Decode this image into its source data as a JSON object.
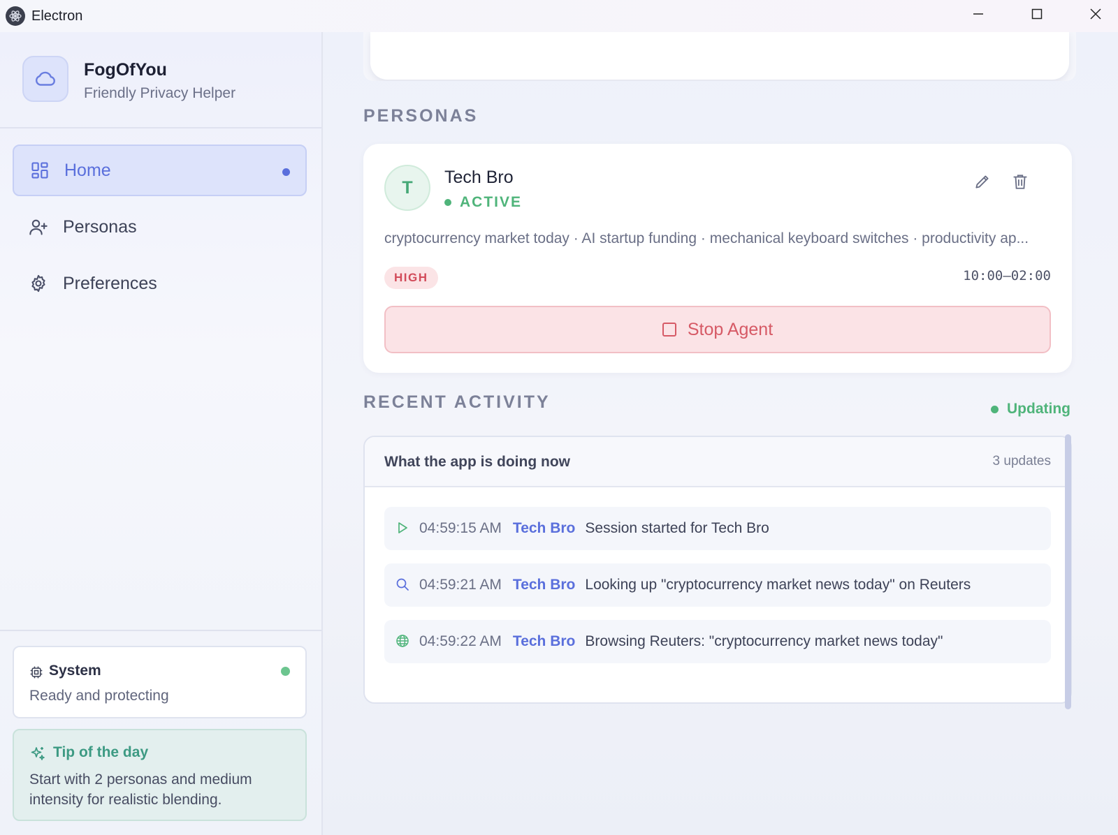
{
  "window": {
    "title": "Electron"
  },
  "brand": {
    "name": "FogOfYou",
    "subtitle": "Friendly Privacy Helper"
  },
  "nav": {
    "items": [
      {
        "label": "Home",
        "icon": "grid-icon",
        "active": true
      },
      {
        "label": "Personas",
        "icon": "user-plus-icon",
        "active": false
      },
      {
        "label": "Preferences",
        "icon": "gear-icon",
        "active": false
      }
    ]
  },
  "system": {
    "title": "System",
    "status": "Ready and protecting",
    "status_color": "#6cc58f"
  },
  "tip": {
    "title": "Tip of the day",
    "text": "Start with 2 personas and medium intensity for realistic blending."
  },
  "sections": {
    "personas": "PERSONAS",
    "activity": "RECENT ACTIVITY"
  },
  "persona": {
    "initial": "T",
    "name": "Tech Bro",
    "status": "ACTIVE",
    "topics": "cryptocurrency market today · AI startup funding · mechanical keyboard switches · productivity ap...",
    "intensity": "HIGH",
    "schedule": "10:00–02:00",
    "stop_label": "Stop Agent"
  },
  "activity": {
    "updating": "Updating",
    "header": "What the app is doing now",
    "count": "3 updates",
    "rows": [
      {
        "icon": "play-icon",
        "time": "04:59:15 AM",
        "persona": "Tech Bro",
        "message": "Session started for Tech Bro"
      },
      {
        "icon": "search-icon",
        "time": "04:59:21 AM",
        "persona": "Tech Bro",
        "message": "Looking up \"cryptocurrency market news today\" on Reuters"
      },
      {
        "icon": "globe-icon",
        "time": "04:59:22 AM",
        "persona": "Tech Bro",
        "message": "Browsing Reuters: \"cryptocurrency market news today\""
      }
    ]
  },
  "colors": {
    "accent": "#5a6fdc",
    "success": "#4fb47a",
    "danger": "#d65a66"
  }
}
